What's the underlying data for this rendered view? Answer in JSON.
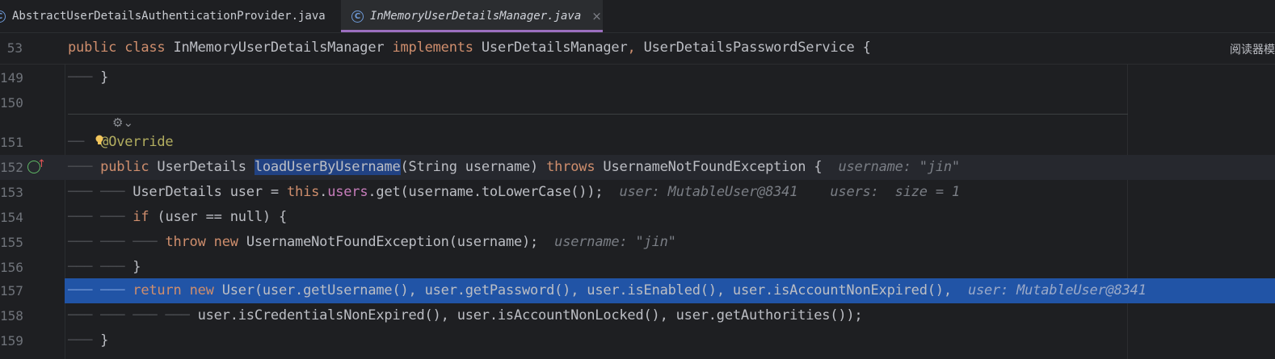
{
  "tabs": [
    {
      "label": "AbstractUserDetailsAuthenticationProvider.java",
      "active": false,
      "icon": "class-icon"
    },
    {
      "label": "InMemoryUserDetailsManager.java",
      "active": true,
      "icon": "class-icon",
      "close": "×"
    }
  ],
  "class_icon_glyph": "C",
  "reader_mode": "阅读器模",
  "sticky_line": {
    "num": "53",
    "kw1": "public",
    "kw2": "class",
    "name": "InMemoryUserDetailsManager",
    "kw3": "implements",
    "if1": "UserDetailsManager",
    "comma": ",",
    "if2": "UserDetailsPasswordService",
    "brace": "{"
  },
  "lines": {
    "l149": {
      "num": "149",
      "text": "}"
    },
    "l150": {
      "num": "150"
    },
    "l151": {
      "num": "151",
      "text": "@Override"
    },
    "l152": {
      "num": "152",
      "kw1": "public",
      "type": "UserDetails",
      "method": "loadUserByUsername",
      "params": "(String username)",
      "kw2": "throws",
      "exc": "UsernameNotFoundException {",
      "hint": "username: \"jin\""
    },
    "l153": {
      "num": "153",
      "type": "UserDetails",
      "var": "user =",
      "kw": "this",
      "dot": ".",
      "field": "users",
      "rest": ".get(username.toLowerCase());",
      "hint": "user: MutableUser@8341    users:  size = 1"
    },
    "l154": {
      "num": "154",
      "kw": "if",
      "rest": "(user == null) {",
      "kwnull": ""
    },
    "l155": {
      "num": "155",
      "kw1": "throw",
      "kw2": "new",
      "rest": "UsernameNotFoundException(username);",
      "hint": "username: \"jin\""
    },
    "l156": {
      "num": "156",
      "text": "}"
    },
    "l157": {
      "num": "157",
      "kw1": "return",
      "kw2": "new",
      "rest": "User(user.getUsername(), user.getPassword(), user.isEnabled(), user.isAccountNonExpired(),",
      "hint": "user: MutableUser@8341"
    },
    "l158": {
      "num": "158",
      "rest": "user.isCredentialsNonExpired(), user.isAccountNonLocked(), user.getAuthorities());"
    },
    "l159": {
      "num": "159",
      "text": "}"
    }
  },
  "colors": {
    "keyword": "#cf8e6d",
    "field": "#c77dbb",
    "annotation": "#b3ae60",
    "hint": "#7a7e85",
    "exec_line": "#2154a6",
    "active_tab_indicator": "#9c6fbf"
  }
}
